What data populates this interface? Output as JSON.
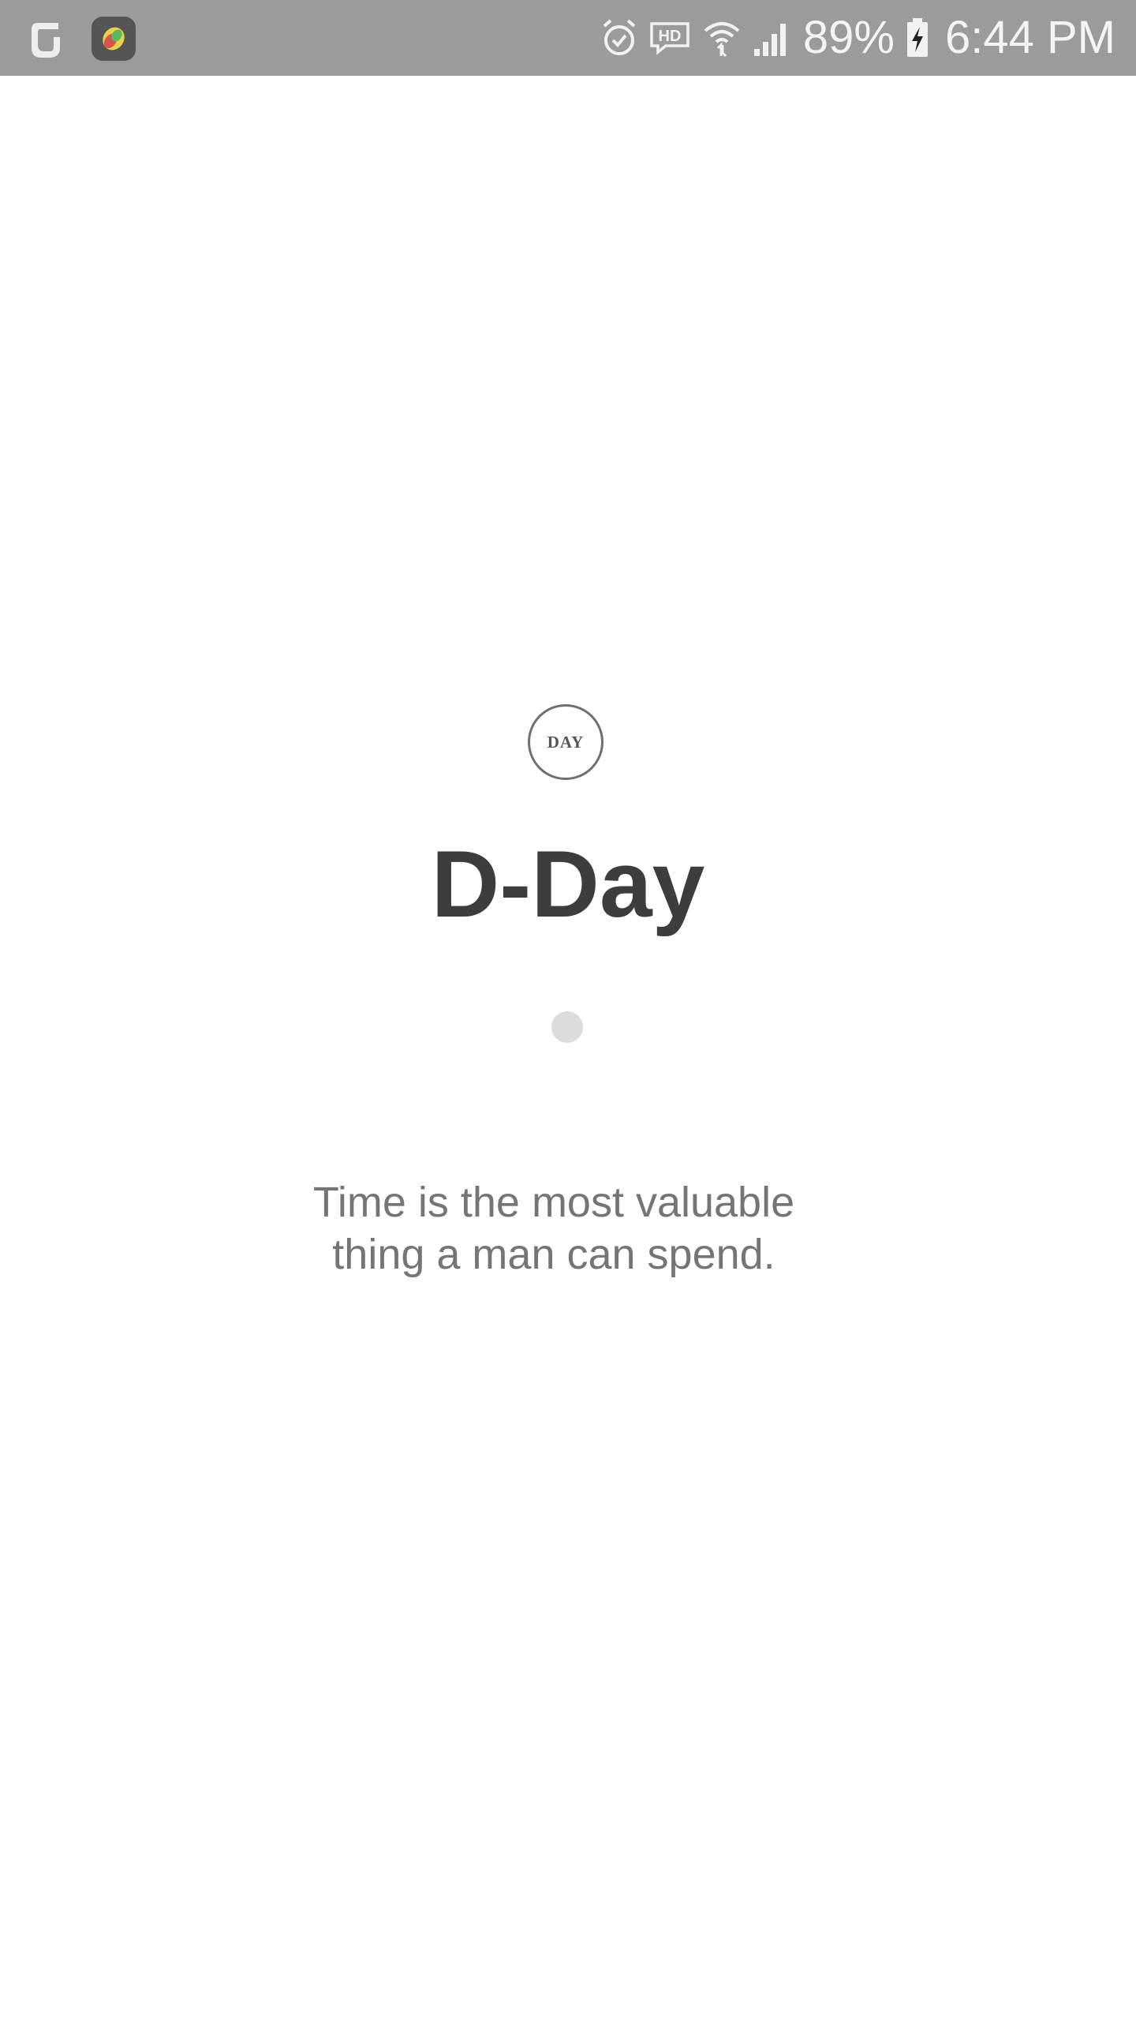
{
  "status_bar": {
    "left_icons": [
      "notification-app-icon",
      "color-app-icon"
    ],
    "right_icons": [
      "alarm-icon",
      "hd-voice-icon",
      "wifi-icon",
      "signal-icon",
      "battery-charging-icon"
    ],
    "battery_percent": "89%",
    "time": "6:44 PM"
  },
  "splash": {
    "logo_text": "DAY",
    "title": "D-Day",
    "quote": "Time is the most valuable\nthing a man can spend."
  },
  "colors": {
    "status_bar_bg": "#9b9b9b",
    "title": "#3d3d3d",
    "quote": "#757575",
    "loading_dot": "#dcdcdc"
  }
}
